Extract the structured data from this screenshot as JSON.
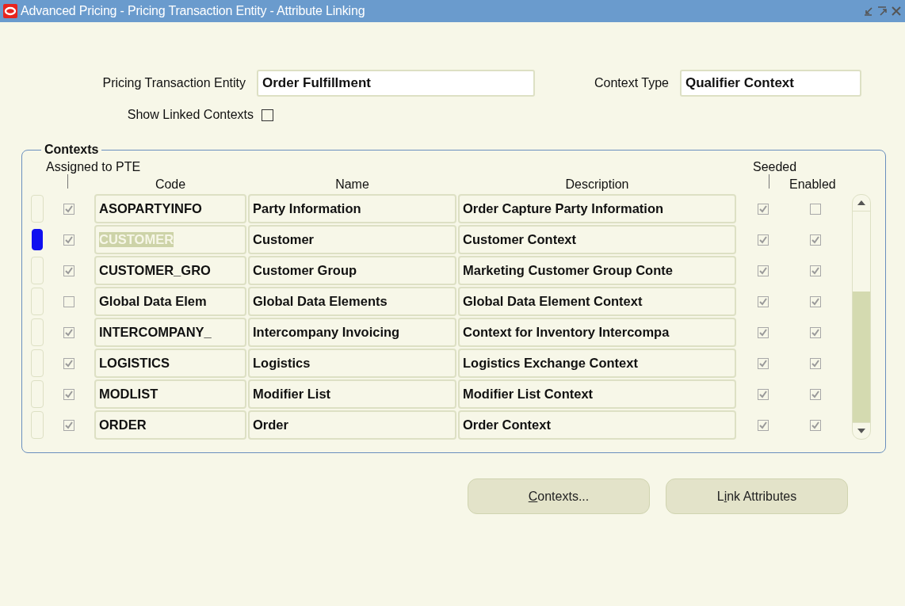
{
  "window": {
    "title": "Advanced Pricing - Pricing Transaction Entity - Attribute Linking"
  },
  "header_fields": [
    {
      "label": "Pricing Transaction Entity",
      "value": "Order Fulfillment"
    },
    {
      "label": "Context Type",
      "value": "Qualifier Context"
    }
  ],
  "show_linked_contexts": {
    "label": "Show Linked Contexts",
    "checked": false
  },
  "contexts": {
    "title": "Contexts",
    "column_headers": {
      "assigned": "Assigned to PTE",
      "code": "Code",
      "name": "Name",
      "description": "Description",
      "seeded": "Seeded",
      "enabled": "Enabled"
    },
    "rows": [
      {
        "selected": false,
        "assigned": true,
        "code": "ASOPARTYINFO",
        "name": "Party Information",
        "description": "Order Capture Party Information",
        "seeded": true,
        "enabled": false
      },
      {
        "selected": true,
        "assigned": true,
        "code": "CUSTOMER",
        "name": "Customer",
        "description": "Customer Context",
        "seeded": true,
        "enabled": true
      },
      {
        "selected": false,
        "assigned": true,
        "code": "CUSTOMER_GRO",
        "name": "Customer Group",
        "description": "Marketing Customer Group Conte",
        "seeded": true,
        "enabled": true
      },
      {
        "selected": false,
        "assigned": false,
        "code": "Global Data Elem",
        "name": "Global Data Elements",
        "description": "Global Data Element Context",
        "seeded": true,
        "enabled": true
      },
      {
        "selected": false,
        "assigned": true,
        "code": "INTERCOMPANY_",
        "name": "Intercompany Invoicing",
        "description": "Context for Inventory Intercompa",
        "seeded": true,
        "enabled": true
      },
      {
        "selected": false,
        "assigned": true,
        "code": "LOGISTICS",
        "name": "Logistics",
        "description": "Logistics Exchange Context",
        "seeded": true,
        "enabled": true
      },
      {
        "selected": false,
        "assigned": true,
        "code": "MODLIST",
        "name": "Modifier List",
        "description": "Modifier List Context",
        "seeded": true,
        "enabled": true
      },
      {
        "selected": false,
        "assigned": true,
        "code": "ORDER",
        "name": "Order",
        "description": "Order Context",
        "seeded": true,
        "enabled": true
      }
    ]
  },
  "buttons": [
    {
      "access_key": "C",
      "label_after": "ontexts..."
    },
    {
      "label_before": "L",
      "access_key": "i",
      "label_after": "nk Attributes"
    }
  ]
}
